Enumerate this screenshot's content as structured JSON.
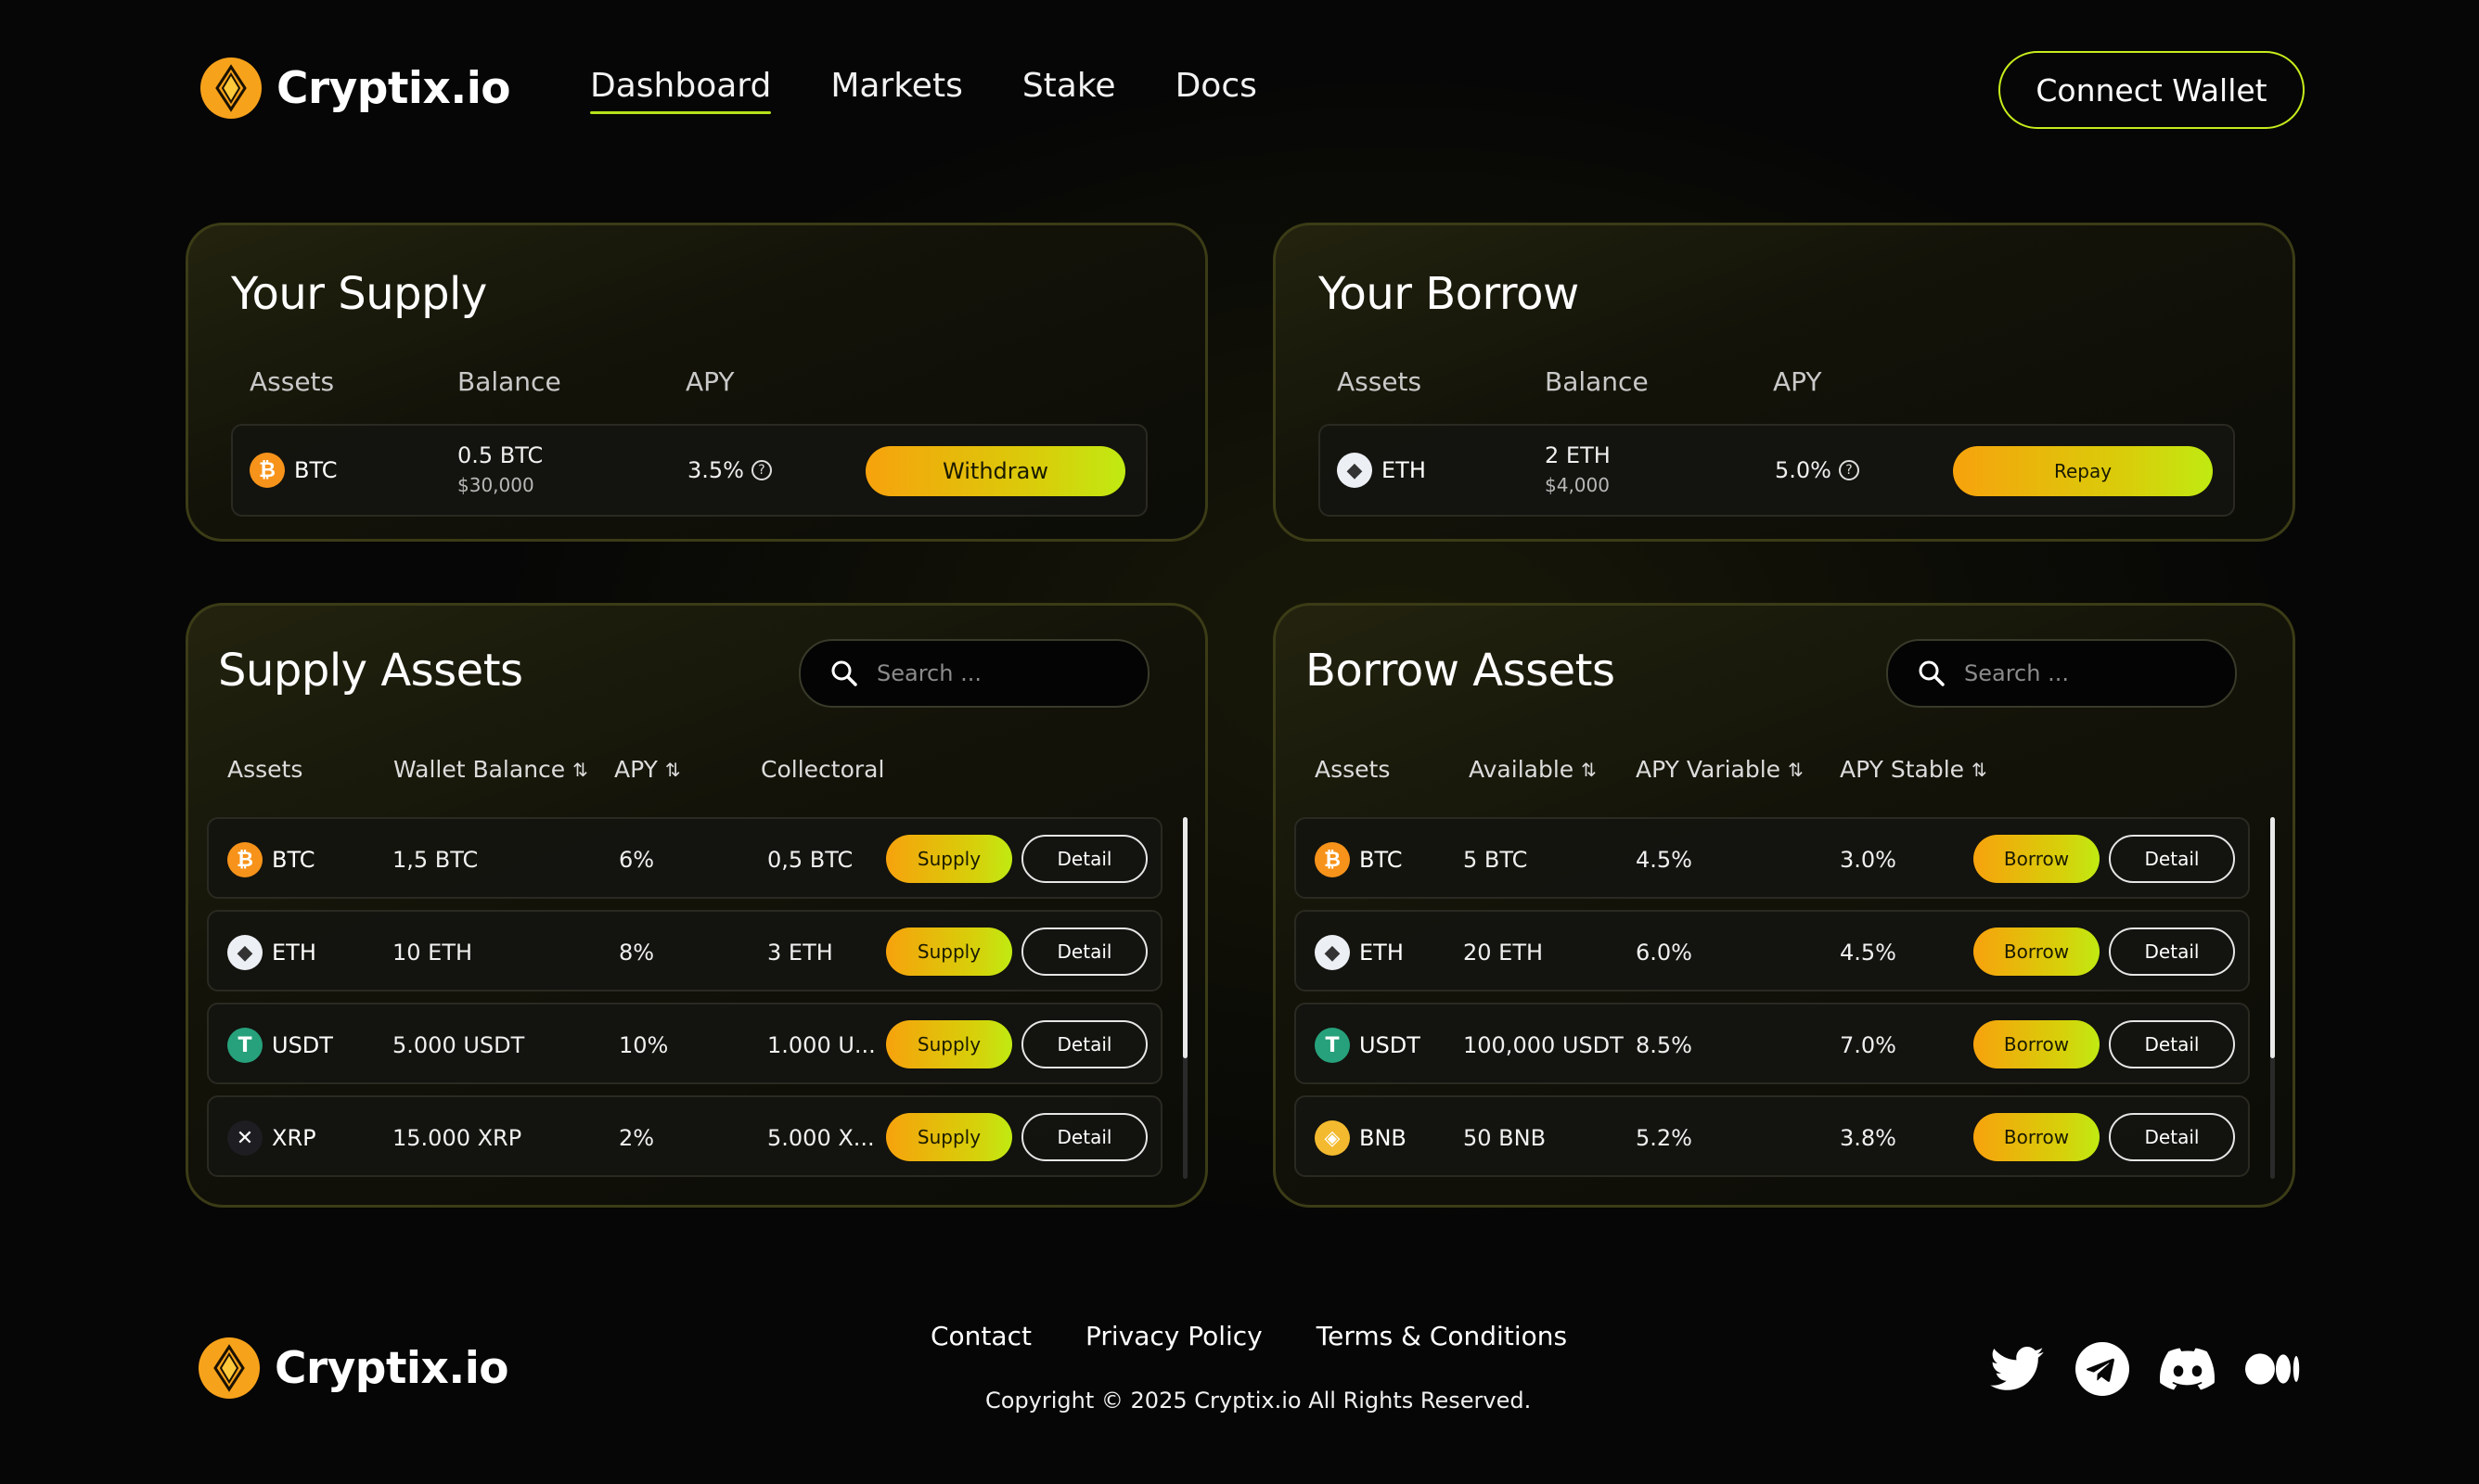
{
  "brand": {
    "name": "Cryptix.io",
    "accent": "#c6ec1c",
    "orange": "#f7a21b"
  },
  "nav": {
    "items": [
      {
        "label": "Dashboard",
        "active": true
      },
      {
        "label": "Markets"
      },
      {
        "label": "Stake"
      },
      {
        "label": "Docs"
      }
    ],
    "connect_label": "Connect Wallet"
  },
  "your_supply": {
    "title": "Your Supply",
    "headers": [
      "Assets",
      "Balance",
      "APY"
    ],
    "row": {
      "asset": "BTC",
      "balance": "0.5 BTC",
      "value": "$30,000",
      "apy": "3.5%",
      "action": "Withdraw"
    }
  },
  "your_borrow": {
    "title": "Your Borrow",
    "headers": [
      "Assets",
      "Balance",
      "APY"
    ],
    "row": {
      "asset": "ETH",
      "balance": "2 ETH",
      "value": "$4,000",
      "apy": "5.0%",
      "action": "Repay"
    }
  },
  "supply_assets": {
    "title": "Supply Assets",
    "search_placeholder": "Search ...",
    "headers": [
      "Assets",
      "Wallet Balance",
      "APY",
      "Collectoral"
    ],
    "rows": [
      {
        "asset": "BTC",
        "wallet": "1,5 BTC",
        "apy": "6%",
        "collateral": "0,5 BTC",
        "action": "Supply",
        "detail": "Detail"
      },
      {
        "asset": "ETH",
        "wallet": "10 ETH",
        "apy": "8%",
        "collateral": "3 ETH",
        "action": "Supply",
        "detail": "Detail"
      },
      {
        "asset": "USDT",
        "wallet": "5.000 USDT",
        "apy": "10%",
        "collateral": "1.000 U...",
        "action": "Supply",
        "detail": "Detail"
      },
      {
        "asset": "XRP",
        "wallet": "15.000 XRP",
        "apy": "2%",
        "collateral": "5.000 X...",
        "action": "Supply",
        "detail": "Detail"
      }
    ]
  },
  "borrow_assets": {
    "title": "Borrow Assets",
    "search_placeholder": "Search ...",
    "headers": [
      "Assets",
      "Available",
      "APY Variable",
      "APY Stable"
    ],
    "rows": [
      {
        "asset": "BTC",
        "available": "5 BTC",
        "apy_var": "4.5%",
        "apy_stable": "3.0%",
        "action": "Borrow",
        "detail": "Detail"
      },
      {
        "asset": "ETH",
        "available": "20 ETH",
        "apy_var": "6.0%",
        "apy_stable": "4.5%",
        "action": "Borrow",
        "detail": "Detail"
      },
      {
        "asset": "USDT",
        "available": "100,000 USDT",
        "apy_var": "8.5%",
        "apy_stable": "7.0%",
        "action": "Borrow",
        "detail": "Detail"
      },
      {
        "asset": "BNB",
        "available": "50 BNB",
        "apy_var": "5.2%",
        "apy_stable": "3.8%",
        "action": "Borrow",
        "detail": "Detail"
      }
    ]
  },
  "footer": {
    "links": [
      "Contact",
      "Privacy Policy",
      "Terms & Conditions"
    ],
    "copyright": "Copyright © 2025 Cryptix.io All Rights Reserved.",
    "social": [
      "twitter-icon",
      "telegram-icon",
      "discord-icon",
      "medium-icon"
    ]
  },
  "icons": {
    "sort": "⇅",
    "coin_symbols": {
      "BTC": "₿",
      "ETH": "◆",
      "USDT": "T",
      "XRP": "✕",
      "BNB": "◈"
    }
  }
}
